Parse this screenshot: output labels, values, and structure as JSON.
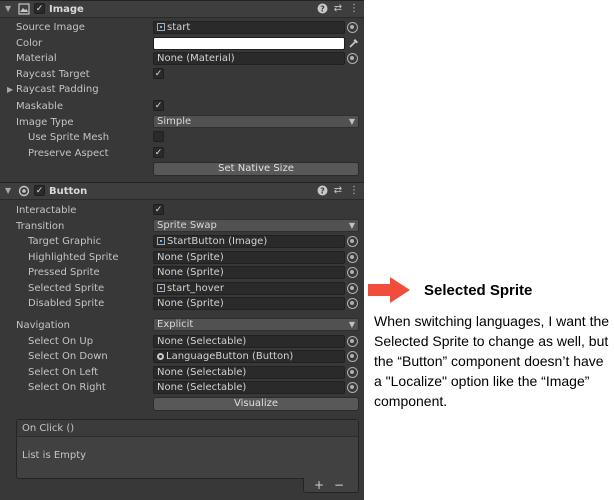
{
  "image_component": {
    "title": "Image",
    "header_icons": [
      "image-icon",
      "help-icon",
      "preset-icon",
      "kebab-menu-icon"
    ],
    "source_image": {
      "label": "Source Image",
      "value": "start"
    },
    "color": {
      "label": "Color",
      "value": "#ffffff"
    },
    "material": {
      "label": "Material",
      "value": "None (Material)"
    },
    "raycast_target": {
      "label": "Raycast Target",
      "checked": true
    },
    "raycast_padding": {
      "label": "Raycast Padding"
    },
    "maskable": {
      "label": "Maskable",
      "checked": true
    },
    "image_type": {
      "label": "Image Type",
      "value": "Simple"
    },
    "use_sprite_mesh": {
      "label": "Use Sprite Mesh",
      "checked": false
    },
    "preserve_aspect": {
      "label": "Preserve Aspect",
      "checked": true
    },
    "set_native_size": "Set Native Size"
  },
  "button_component": {
    "title": "Button",
    "interactable": {
      "label": "Interactable",
      "checked": true
    },
    "transition": {
      "label": "Transition",
      "value": "Sprite Swap"
    },
    "target_graphic": {
      "label": "Target Graphic",
      "value": "StartButton (Image)"
    },
    "highlighted_sprite": {
      "label": "Highlighted Sprite",
      "value": "None (Sprite)"
    },
    "pressed_sprite": {
      "label": "Pressed Sprite",
      "value": "None (Sprite)"
    },
    "selected_sprite": {
      "label": "Selected Sprite",
      "value": "start_hover"
    },
    "disabled_sprite": {
      "label": "Disabled Sprite",
      "value": "None (Sprite)"
    },
    "navigation": {
      "label": "Navigation",
      "value": "Explicit"
    },
    "select_on_up": {
      "label": "Select On Up",
      "value": "None (Selectable)"
    },
    "select_on_down": {
      "label": "Select On Down",
      "value": "LanguageButton (Button)"
    },
    "select_on_left": {
      "label": "Select On Left",
      "value": "None (Selectable)"
    },
    "select_on_right": {
      "label": "Select On Right",
      "value": "None (Selectable)"
    },
    "visualize": "Visualize",
    "on_click": {
      "title": "On Click ()",
      "empty_text": "List is Empty",
      "add": "+",
      "remove": "−"
    }
  },
  "annotation": {
    "heading": "Selected Sprite",
    "text": "When switching languages, I want the Selected Sprite to change as well, but the “Button” component doesn’t have a \"Localize\" option like the “Image” component.",
    "arrow_color": "#f24c3d"
  }
}
